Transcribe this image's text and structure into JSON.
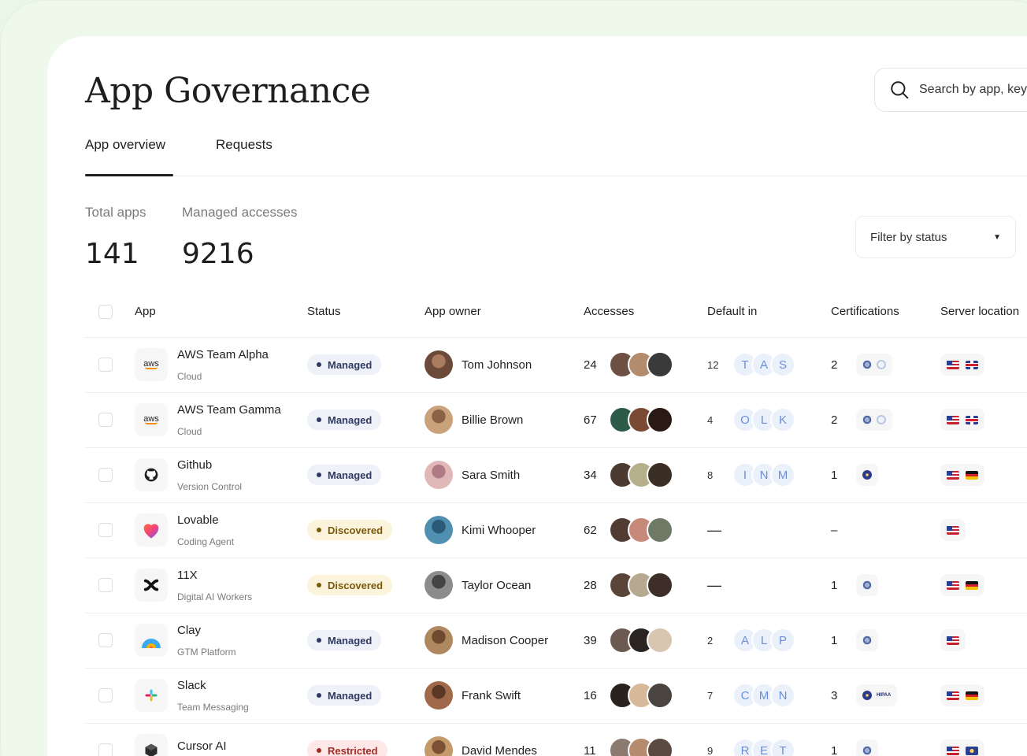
{
  "header": {
    "title": "App Governance",
    "search_placeholder": "Search by app, keyword"
  },
  "tabs": [
    {
      "label": "App overview",
      "active": true
    },
    {
      "label": "Requests",
      "active": false
    }
  ],
  "stats": {
    "total_apps_label": "Total apps",
    "total_apps_value": "141",
    "managed_accesses_label": "Managed accesses",
    "managed_accesses_value": "9216"
  },
  "filter": {
    "label": "Filter by status"
  },
  "table": {
    "columns": [
      "App",
      "Status",
      "App owner",
      "Accesses",
      "Default in",
      "Certifications",
      "Server location"
    ],
    "rows": [
      {
        "app": "AWS Team Alpha",
        "category": "Cloud",
        "logo": "aws-logo",
        "status": "Managed",
        "status_kind": "managed",
        "owner": "Tom Johnson",
        "accesses": "24",
        "default_count": "12",
        "default_letters": [
          "T",
          "A",
          "S"
        ],
        "cert_count": "2",
        "cert_icons": [
          "badge-a",
          "badge-b"
        ],
        "flags": [
          "us",
          "gb"
        ]
      },
      {
        "app": "AWS Team Gamma",
        "category": "Cloud",
        "logo": "aws-logo",
        "status": "Managed",
        "status_kind": "managed",
        "owner": "Billie Brown",
        "accesses": "67",
        "default_count": "4",
        "default_letters": [
          "O",
          "L",
          "K"
        ],
        "cert_count": "2",
        "cert_icons": [
          "badge-a",
          "badge-b"
        ],
        "flags": [
          "us",
          "gb"
        ]
      },
      {
        "app": "Github",
        "category": "Version Control",
        "logo": "github-logo",
        "status": "Managed",
        "status_kind": "managed",
        "owner": "Sara Smith",
        "accesses": "34",
        "default_count": "8",
        "default_letters": [
          "I",
          "N",
          "M"
        ],
        "cert_count": "1",
        "cert_icons": [
          "badge-c"
        ],
        "flags": [
          "us",
          "de"
        ]
      },
      {
        "app": "Lovable",
        "category": "Coding Agent",
        "logo": "lovable-logo",
        "status": "Discovered",
        "status_kind": "discovered",
        "owner": "Kimi Whooper",
        "accesses": "62",
        "default_count": "—",
        "default_letters": [],
        "cert_count": "–",
        "cert_icons": [],
        "flags": [
          "us"
        ]
      },
      {
        "app": "11X",
        "category": "Digital AI Workers",
        "logo": "11x-logo",
        "status": "Discovered",
        "status_kind": "discovered",
        "owner": "Taylor Ocean",
        "accesses": "28",
        "default_count": "—",
        "default_letters": [],
        "cert_count": "1",
        "cert_icons": [
          "badge-a"
        ],
        "flags": [
          "us",
          "de"
        ]
      },
      {
        "app": "Clay",
        "category": "GTM Platform",
        "logo": "clay-logo",
        "status": "Managed",
        "status_kind": "managed",
        "owner": "Madison Cooper",
        "accesses": "39",
        "default_count": "2",
        "default_letters": [
          "A",
          "L",
          "P"
        ],
        "cert_count": "1",
        "cert_icons": [
          "badge-a"
        ],
        "flags": [
          "us"
        ]
      },
      {
        "app": "Slack",
        "category": "Team Messaging",
        "logo": "slack-logo",
        "status": "Managed",
        "status_kind": "managed",
        "owner": "Frank Swift",
        "accesses": "16",
        "default_count": "7",
        "default_letters": [
          "C",
          "M",
          "N"
        ],
        "cert_count": "3",
        "cert_icons": [
          "badge-c",
          "hipaa"
        ],
        "hipaa_label": "HIPAA",
        "flags": [
          "us",
          "de"
        ]
      },
      {
        "app": "Cursor AI",
        "category": "",
        "logo": "cursor-logo",
        "status": "Restricted",
        "status_kind": "restricted",
        "owner": "David Mendes",
        "accesses": "11",
        "default_count": "9",
        "default_letters": [
          "R",
          "E",
          "T"
        ],
        "cert_count": "1",
        "cert_icons": [
          "badge-a"
        ],
        "flags": [
          "us",
          "eu"
        ]
      }
    ]
  },
  "colors": {
    "background": "#eef9ec",
    "managed": "#2f3a63",
    "discovered": "#7a5a0a",
    "restricted": "#a12b25",
    "letter_chip": "#6b8fd6"
  }
}
